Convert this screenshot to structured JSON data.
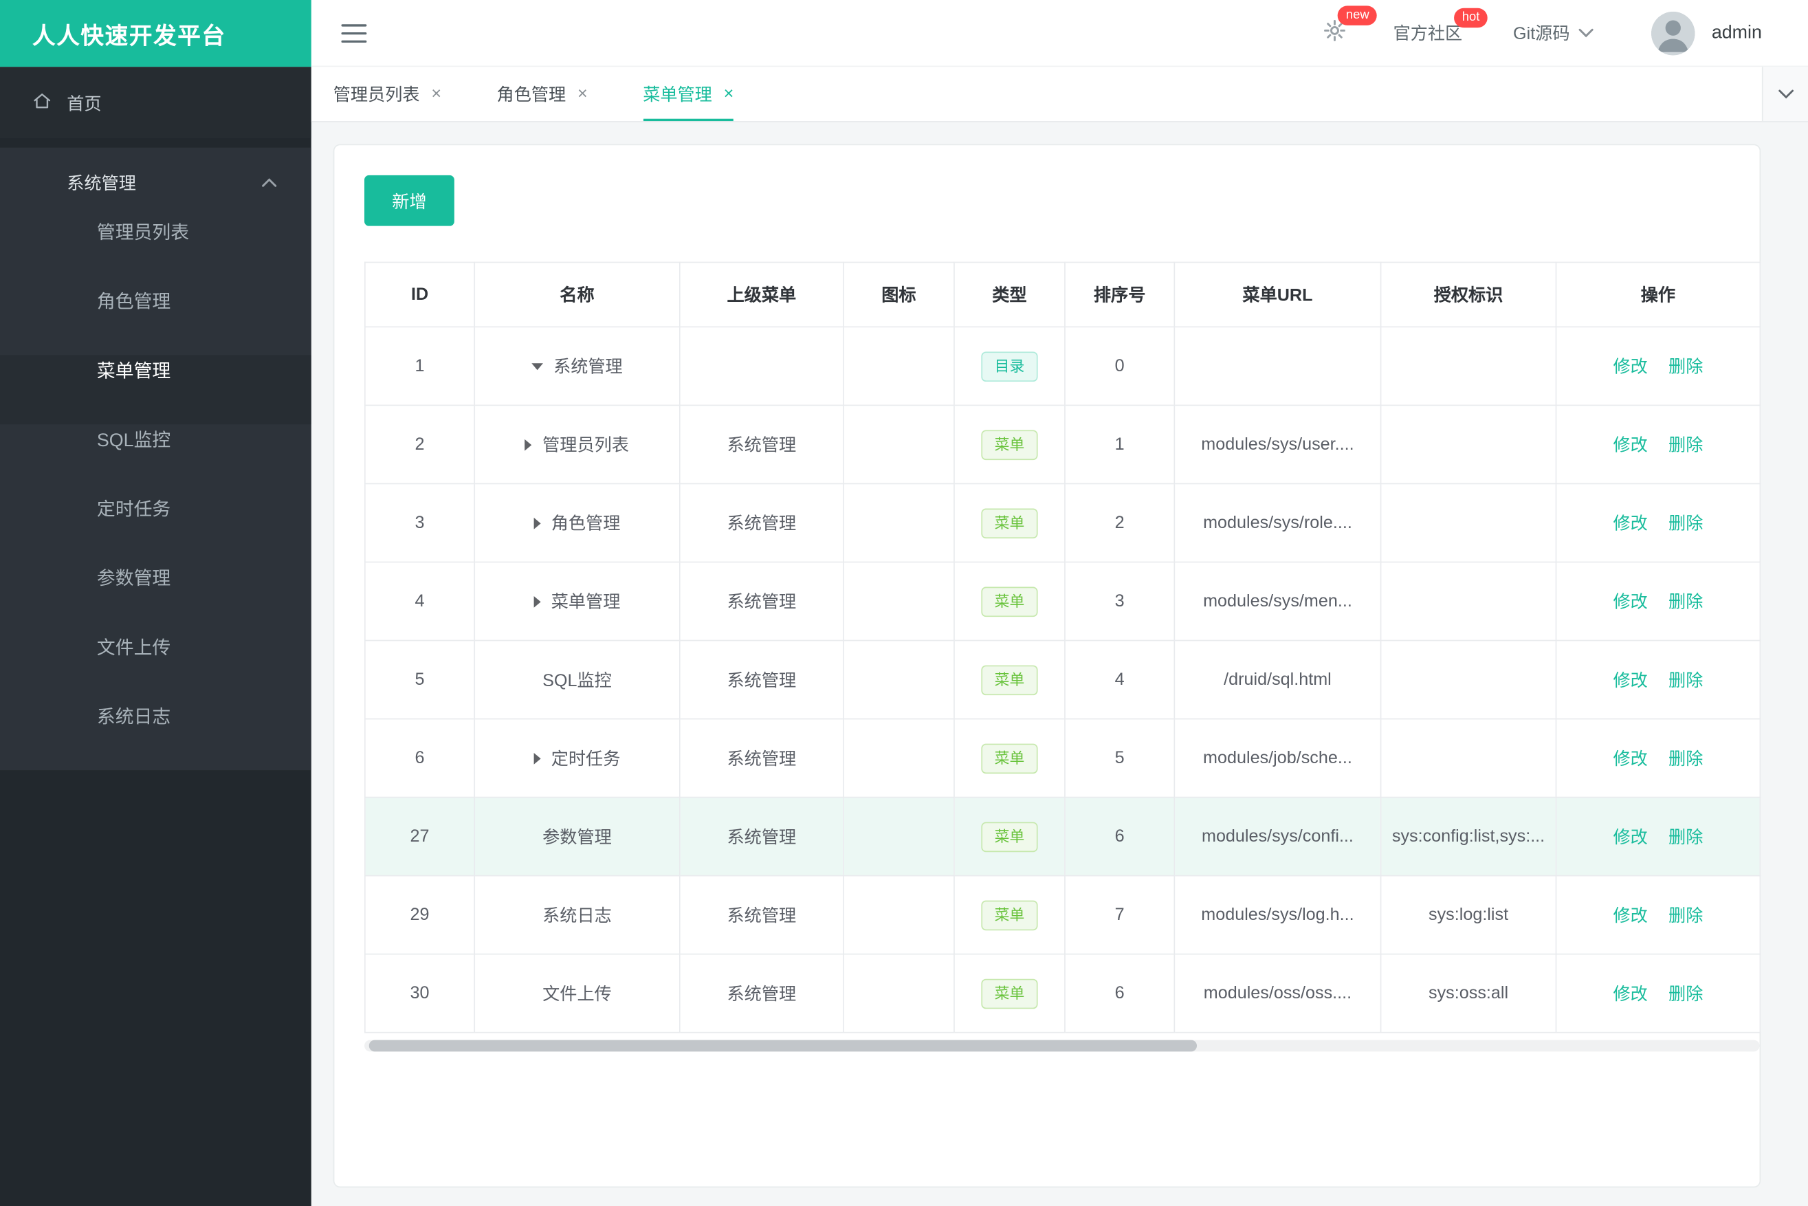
{
  "app": {
    "title": "人人快速开发平台"
  },
  "header": {
    "gear_badge": "new",
    "community": "官方社区",
    "community_badge": "hot",
    "git": "Git源码",
    "username": "admin"
  },
  "sidebar": {
    "home": "首页",
    "section": "系统管理",
    "items": [
      {
        "label": "管理员列表",
        "active": false
      },
      {
        "label": "角色管理",
        "active": false
      },
      {
        "label": "菜单管理",
        "active": true
      },
      {
        "label": "SQL监控",
        "active": false
      },
      {
        "label": "定时任务",
        "active": false
      },
      {
        "label": "参数管理",
        "active": false
      },
      {
        "label": "文件上传",
        "active": false
      },
      {
        "label": "系统日志",
        "active": false
      }
    ]
  },
  "tabs": [
    {
      "label": "管理员列表",
      "active": false
    },
    {
      "label": "角色管理",
      "active": false
    },
    {
      "label": "菜单管理",
      "active": true
    }
  ],
  "toolbar": {
    "add": "新增"
  },
  "table": {
    "headers": [
      "ID",
      "名称",
      "上级菜单",
      "图标",
      "类型",
      "排序号",
      "菜单URL",
      "授权标识",
      "操作"
    ],
    "actions": {
      "edit": "修改",
      "delete": "删除"
    },
    "rows": [
      {
        "id": "1",
        "arrow": "down",
        "name": "系统管理",
        "parent": "",
        "icon": "",
        "type": "目录",
        "type_kind": "dir",
        "order": "0",
        "url": "",
        "auth": "",
        "highlight": false
      },
      {
        "id": "2",
        "arrow": "right",
        "name": "管理员列表",
        "parent": "系统管理",
        "icon": "",
        "type": "菜单",
        "type_kind": "menu",
        "order": "1",
        "url": "modules/sys/user....",
        "auth": "",
        "highlight": false
      },
      {
        "id": "3",
        "arrow": "right",
        "name": "角色管理",
        "parent": "系统管理",
        "icon": "",
        "type": "菜单",
        "type_kind": "menu",
        "order": "2",
        "url": "modules/sys/role....",
        "auth": "",
        "highlight": false
      },
      {
        "id": "4",
        "arrow": "right",
        "name": "菜单管理",
        "parent": "系统管理",
        "icon": "",
        "type": "菜单",
        "type_kind": "menu",
        "order": "3",
        "url": "modules/sys/men...",
        "auth": "",
        "highlight": false
      },
      {
        "id": "5",
        "arrow": "",
        "name": "SQL监控",
        "parent": "系统管理",
        "icon": "",
        "type": "菜单",
        "type_kind": "menu",
        "order": "4",
        "url": "/druid/sql.html",
        "auth": "",
        "highlight": false
      },
      {
        "id": "6",
        "arrow": "right",
        "name": "定时任务",
        "parent": "系统管理",
        "icon": "",
        "type": "菜单",
        "type_kind": "menu",
        "order": "5",
        "url": "modules/job/sche...",
        "auth": "",
        "highlight": false
      },
      {
        "id": "27",
        "arrow": "",
        "name": "参数管理",
        "parent": "系统管理",
        "icon": "",
        "type": "菜单",
        "type_kind": "menu",
        "order": "6",
        "url": "modules/sys/confi...",
        "auth": "sys:config:list,sys:...",
        "highlight": true
      },
      {
        "id": "29",
        "arrow": "",
        "name": "系统日志",
        "parent": "系统管理",
        "icon": "",
        "type": "菜单",
        "type_kind": "menu",
        "order": "7",
        "url": "modules/sys/log.h...",
        "auth": "sys:log:list",
        "highlight": false
      },
      {
        "id": "30",
        "arrow": "",
        "name": "文件上传",
        "parent": "系统管理",
        "icon": "",
        "type": "菜单",
        "type_kind": "menu",
        "order": "6",
        "url": "modules/oss/oss....",
        "auth": "sys:oss:all",
        "highlight": false
      }
    ]
  },
  "colors": {
    "brand": "#18bc9c",
    "badge_red": "#ff4949",
    "tag_dir_text": "#18bc9c",
    "tag_menu_text": "#67c23a",
    "sidebar_bg": "#22282d",
    "sidebar_section_bg": "#2d333a",
    "row_highlight": "#ecf8f4"
  }
}
